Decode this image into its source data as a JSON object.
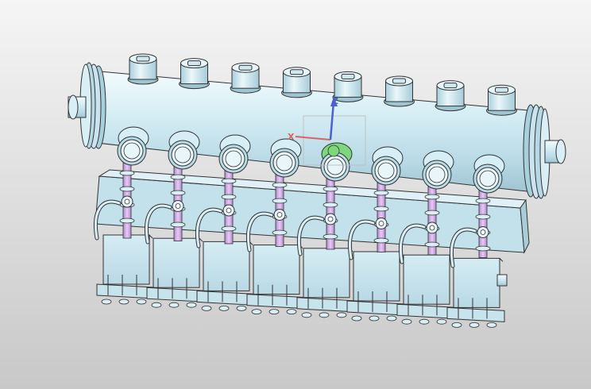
{
  "viewport": {
    "background_top": "#f5f5f5",
    "background_bottom": "#c8c8c8"
  },
  "model": {
    "part_fill": "#c9e4ee",
    "part_fill_light": "#e3f3f8",
    "part_fill_dark": "#9fc4d2",
    "outline": "#333333",
    "tube_color": "#c9a2e0",
    "cap_count": 8,
    "valve_count": 8,
    "module_count": 8,
    "highlight_color": "#7dd87d"
  },
  "triad": {
    "x_label": "X",
    "z_label": "Z",
    "x_color": "#e06060",
    "y_color": "#60b060",
    "z_color": "#4a5fd0",
    "box_color": "#c0c0c0"
  }
}
